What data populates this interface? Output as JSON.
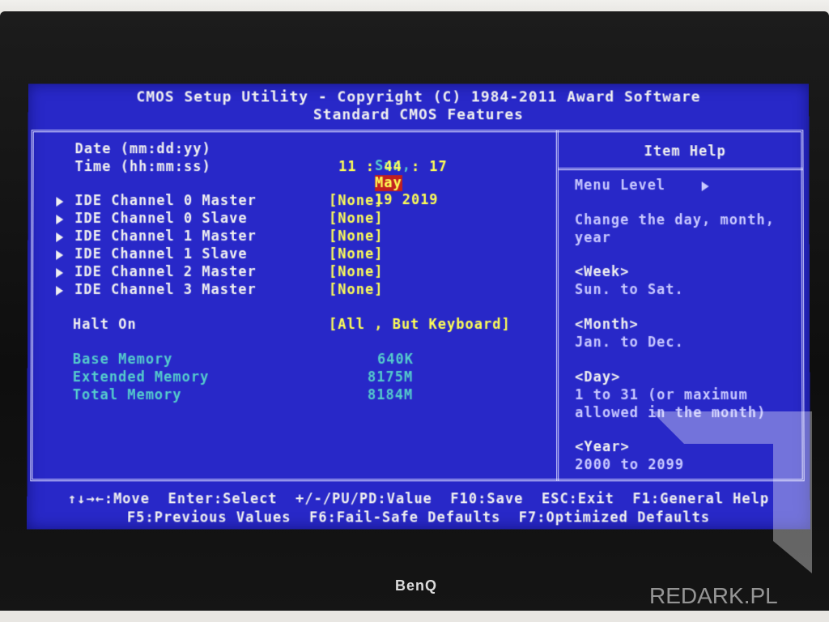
{
  "header": {
    "title": "CMOS Setup Utility - Copyright (C) 1984-2011 Award Software",
    "subtitle": "Standard CMOS Features"
  },
  "settings": {
    "date_label": "Date (mm:dd:yy)",
    "date_weekday": "Sun,",
    "date_month": "May",
    "date_rest": "19 2019",
    "time_label": "Time (hh:mm:ss)",
    "time_value": "11 : 44 : 17",
    "ide": [
      {
        "label": "IDE Channel 0 Master",
        "value": "[None]"
      },
      {
        "label": "IDE Channel 0 Slave",
        "value": "[None]"
      },
      {
        "label": "IDE Channel 1 Master",
        "value": "[None]"
      },
      {
        "label": "IDE Channel 1 Slave",
        "value": "[None]"
      },
      {
        "label": "IDE Channel 2 Master",
        "value": "[None]"
      },
      {
        "label": "IDE Channel 3 Master",
        "value": "[None]"
      }
    ],
    "halt_label": "Halt On",
    "halt_value": "[All , But Keyboard]",
    "memory": [
      {
        "label": "Base Memory",
        "value": "640K"
      },
      {
        "label": "Extended Memory",
        "value": "8175M"
      },
      {
        "label": "Total Memory",
        "value": "8184M"
      }
    ]
  },
  "help": {
    "title": "Item Help",
    "menu_level": "Menu Level",
    "line1": "Change the day, month,",
    "line2": "year",
    "week_h": "<Week>",
    "week_t": "Sun. to Sat.",
    "month_h": "<Month>",
    "month_t": "Jan. to Dec.",
    "day_h": "<Day>",
    "day_t1": "1 to 31 (or maximum",
    "day_t2": "allowed in the month)",
    "year_h": "<Year>",
    "year_t": "2000 to 2099"
  },
  "footer": {
    "line1": "↑↓→←:Move  Enter:Select  +/-/PU/PD:Value  F10:Save  ESC:Exit  F1:General Help",
    "line2": "F5:Previous Values  F6:Fail-Safe Defaults  F7:Optimized Defaults"
  },
  "monitor": {
    "brand": "BenQ"
  },
  "watermark": {
    "text": "REDARK.PL"
  },
  "colors": {
    "background": "#2828c8",
    "highlight": "#c02020",
    "value": "#ffff55",
    "memory": "#55cccc"
  }
}
